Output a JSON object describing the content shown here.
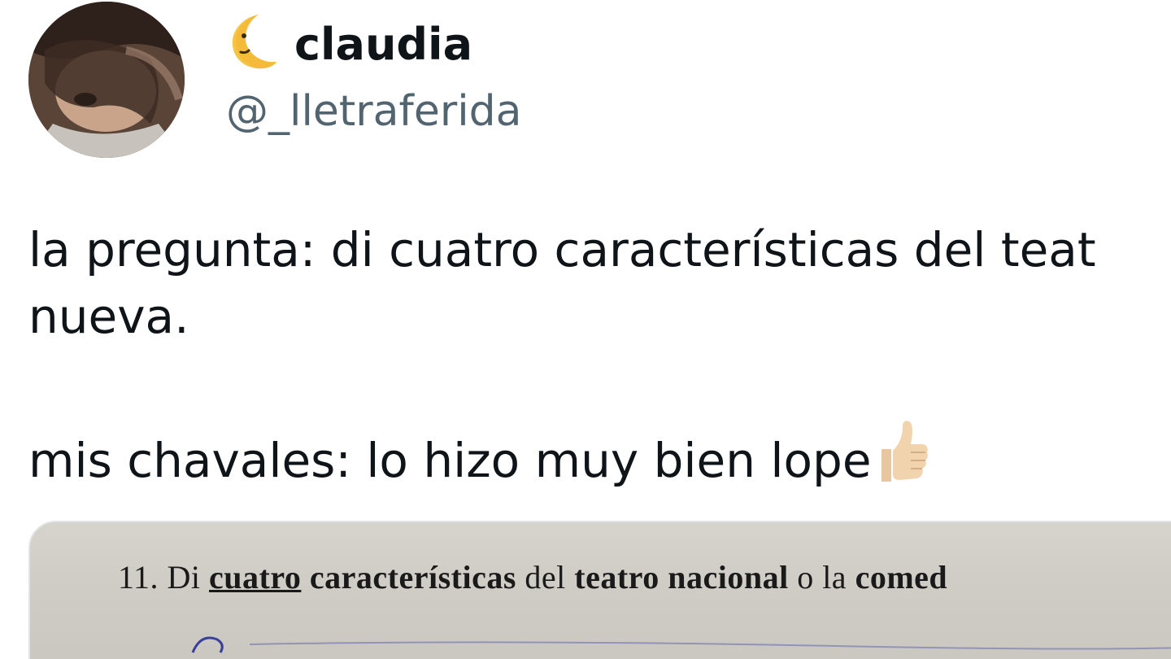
{
  "user": {
    "display_name": "claudia",
    "handle": "@_lletraferida",
    "name_emoji": "crescent-moon-face-icon"
  },
  "tweet": {
    "line1": "la pregunta: di cuatro características del teat",
    "line2": "nueva.",
    "line3": "mis chavales: lo hizo muy bien lope",
    "emoji": "thumbs-up-icon"
  },
  "photo": {
    "number": "11.",
    "word1": "Di",
    "word2": "cuatro",
    "word3": "características",
    "word4": "del",
    "word5": "teatro nacional",
    "word6": "o la",
    "word7": "comed"
  },
  "colors": {
    "text_primary": "#0f1419",
    "text_secondary": "#536471",
    "paper": "#d2cfc8",
    "ink": "#3a3f9a"
  }
}
